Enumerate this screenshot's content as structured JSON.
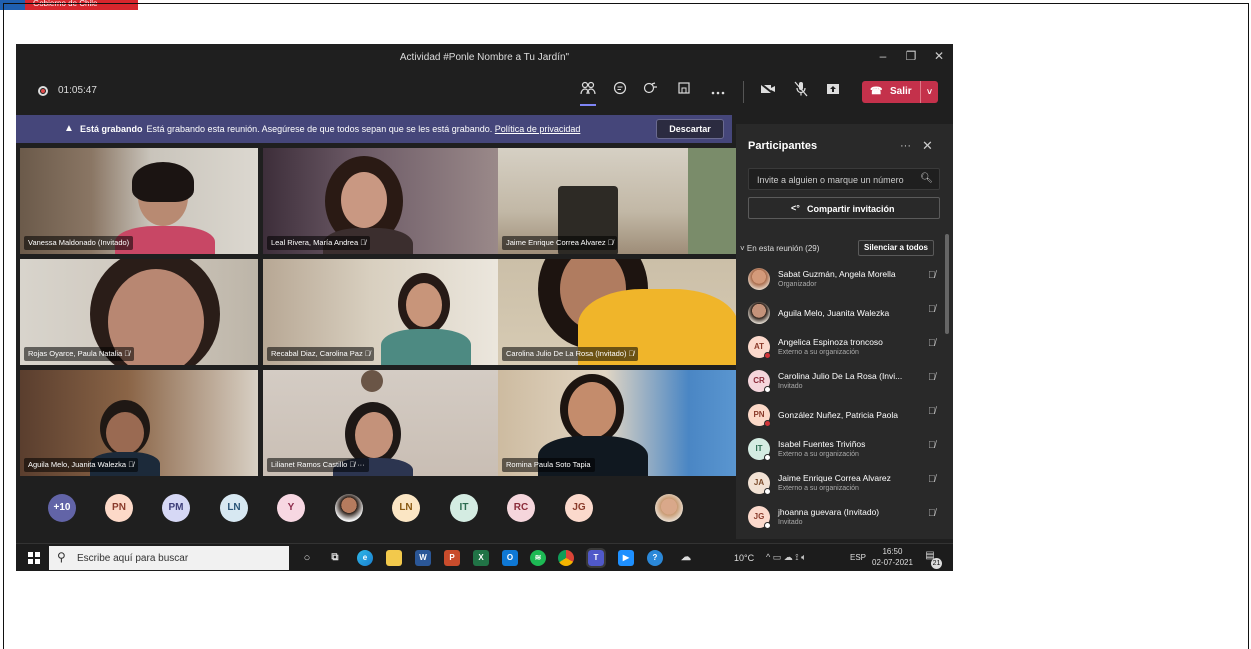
{
  "logo": {
    "text": "Gobierno de Chile"
  },
  "window": {
    "title": "Actividad #Ponle Nombre a Tu Jardín\"",
    "minimize": "–",
    "restore": "❐",
    "close": "✕"
  },
  "toolbar": {
    "timer": "01:05:47",
    "icons": [
      "people-icon",
      "chat-icon",
      "reactions-icon",
      "rooms-icon",
      "more-icon",
      "camera-off-icon",
      "mic-off-icon",
      "share-icon"
    ],
    "leave_label": "Salir",
    "leave_icon": "☎"
  },
  "banner": {
    "title": "Está grabando",
    "message": "Está grabando esta reunión. Asegúrese de que todos sepan que se les está grabando.",
    "link": "Política de privacidad",
    "discard": "Descartar"
  },
  "tiles": [
    {
      "name": "Vanessa Maldonado (Invitado)"
    },
    {
      "name": "Leal Rivera, María Andrea  🎙̸"
    },
    {
      "name": "Jaime Enrique Correa Alvarez  🎙̸"
    },
    {
      "name": "Rojas Oyarce, Paula Natalia  🎙̸"
    },
    {
      "name": "Recabal Diaz, Carolina Paz  🎙̸"
    },
    {
      "name": "Carolina Julio De La Rosa (Invitado)  🎙̸"
    },
    {
      "name": "Aguila Melo, Juanita Walezka  🎙̸"
    },
    {
      "name": "Lilianet Ramos Castillo  🎙̸ ···"
    },
    {
      "name": "Romina Paula Soto Tapia"
    }
  ],
  "avatar_row": [
    "+10",
    "PN",
    "PM",
    "LN",
    "Y",
    "",
    "LN",
    "IT",
    "RC",
    "JG",
    ""
  ],
  "panel": {
    "title": "Participantes",
    "more": "···",
    "close": "✕",
    "invite_placeholder": "Invite a alguien o marque un número",
    "share_label": "Compartir invitación",
    "section_label": "˅ En esta reunión (29)",
    "mute_all": "Silenciar a todos",
    "participants": [
      {
        "initials": "",
        "name": "Sabat Guzmán, Angela Morella",
        "role": "Organizador"
      },
      {
        "initials": "",
        "name": "Aguila Melo, Juanita Walezka",
        "role": ""
      },
      {
        "initials": "AT",
        "name": "Angelica Espinoza troncoso",
        "role": "Externo a su organización"
      },
      {
        "initials": "CR",
        "name": "Carolina Julio De La Rosa (Invi...",
        "role": "Invitado"
      },
      {
        "initials": "PN",
        "name": "González Nuñez, Patricia Paola",
        "role": ""
      },
      {
        "initials": "IT",
        "name": "Isabel Fuentes Triviños",
        "role": "Externo a su organización"
      },
      {
        "initials": "JA",
        "name": "Jaime Enrique Correa Alvarez",
        "role": "Externo a su organización"
      },
      {
        "initials": "JG",
        "name": "jhoanna guevara (Invitado)",
        "role": "Invitado"
      }
    ]
  },
  "taskbar": {
    "search_placeholder": "Escribe aquí para buscar",
    "temperature": "10°C",
    "language": "ESP",
    "time": "16:50",
    "date": "02-07-2021",
    "notifications": "21"
  },
  "colors": {
    "accent": "#7f85f5",
    "leave": "#c4314b",
    "banner": "#45467a",
    "presence_busy": "#d13438"
  }
}
